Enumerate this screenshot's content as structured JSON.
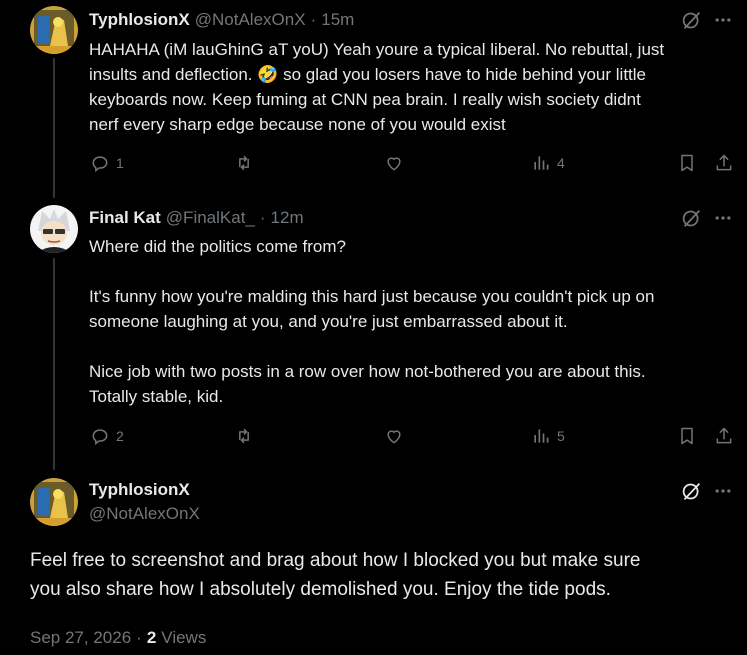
{
  "colors": {
    "background": "#000000",
    "text": "#e7e9ea",
    "muted": "#71767b",
    "thread_line": "#333639"
  },
  "posts": [
    {
      "display_name": "TyphlosionX",
      "handle": "@NotAlexOnX",
      "separator": "·",
      "time": "15m",
      "text_lines": [
        "HAHAHA (iM lauGhinG aT yoU) Yeah youre a typical liberal. No rebuttal, just",
        "insults and deflection. 🤣 so glad you losers have to hide behind your little",
        "keyboards now. Keep fuming at CNN pea brain. I really wish society didnt",
        "nerf every sharp edge because none of you would exist"
      ],
      "replies": "1",
      "views": "4"
    },
    {
      "display_name": "Final Kat",
      "handle": "@FinalKat_",
      "separator": "·",
      "time": "12m",
      "text_lines": [
        "Where did the politics come from?",
        "",
        "It's funny how you're malding this hard just because you couldn't pick up on",
        "someone laughing at you, and you're just embarrassed about it.",
        "",
        "Nice job with two posts in a row over how not-bothered you are about this.",
        "Totally stable, kid."
      ],
      "replies": "2",
      "views": "5"
    }
  ],
  "focus_post": {
    "display_name": "TyphlosionX",
    "handle": "@NotAlexOnX",
    "text_lines": [
      "Feel free to screenshot and brag about how I blocked you but make sure",
      "you also share how I absolutely demolished you. Enjoy the tide pods."
    ],
    "date": "Sep 27, 2026",
    "separator": "·",
    "views_count": "2",
    "views_label": "Views"
  },
  "icons": [
    "grok-icon",
    "more-icon",
    "reply-icon",
    "retweet-icon",
    "like-icon",
    "views-icon",
    "bookmark-icon",
    "share-icon"
  ]
}
